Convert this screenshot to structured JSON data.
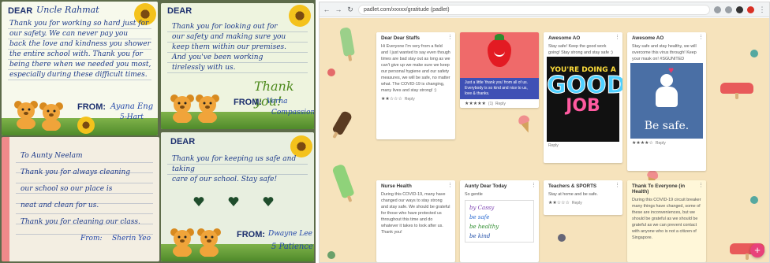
{
  "photo": {
    "card1": {
      "dear": "DEAR",
      "name": "Uncle Rahmat",
      "lines": [
        "Thank you for working so hard just for",
        "our safety. We can never pay you",
        "back the love and kindness you shower",
        "the entire school with. Thank you for",
        "being there when we needed you most,",
        "especially during these difficult times."
      ],
      "from_label": "FROM:",
      "from_name": "Ayana Eng",
      "cls": "5-Hart"
    },
    "card2": {
      "dear": "DEAR",
      "lines": [
        "Thank you for looking out for",
        "our safety and making sure you",
        "keep them within our premises.",
        "And you've been working",
        "tirelessly with us."
      ],
      "shout": "Thank you!",
      "from_label": "FROM:",
      "from_name": "Verna",
      "cls": "Compassion"
    },
    "card3": {
      "lines": [
        "To Aunty Neelam",
        "Thank you for always cleaning",
        "our school so our place is",
        "neat and clean for us.",
        "Thank you for cleaning our class."
      ],
      "from_label": "From:",
      "from_name": "Sherin Yeo"
    },
    "card4": {
      "dear": "DEAR",
      "lines": [
        "Thank you for keeping us safe and taking",
        "care of our school. Stay safe!"
      ],
      "from_label": "FROM:",
      "from_name": "Dwayne Lee",
      "cls": "5 Patience"
    }
  },
  "browser": {
    "nav": {
      "back": "←",
      "forward": "→",
      "reload": "↻"
    },
    "url": "padlet.com/xxxxx/gratitude (padlet)",
    "fab": "+"
  },
  "posts": [
    {
      "title": "Dear Dear Staffs",
      "body": "Hi Everyone I'm very from a field and I just wanted to say even though times are bad stay out as long as we can't give up we make sure we keep our personal hygiene and our safety measures, we will be safe, no matter what. The COVID-19 is changing, many lives and stay strong! :)",
      "stars": "★★☆☆☆",
      "reply": "Reply"
    },
    {
      "banner": "Just a little 'thank you' from all of us. Everybody is so kind and nice to us, love & thanks.",
      "stars": "★★★★★",
      "count": "(1)",
      "reply": "Reply"
    },
    {
      "title": "Awesome AO",
      "body": "Stay safe! Keep the good work going! Stay strong and stay safe :)",
      "img_l1": "YOU'RE DOING A",
      "img_l2": "GOOD",
      "img_l3": "JOB",
      "reply": "Reply"
    },
    {
      "title": "Awesome AO",
      "body": "Stay safe and stay healthy, we will overcome this virus through! Keep your mask on! #SGUNITED",
      "img_text": "Be safe.",
      "stars": "★★★★☆",
      "reply": "Reply"
    },
    {
      "title": "Nurse Health",
      "body": "During this COVID-19, many have changed our ways to stay strong and stay safe. We should be grateful for those who have protected us throughout this time and do whatever it takes to look after us. Thank you!"
    },
    {
      "title": "Aunty Dear Today",
      "body": "So gentle",
      "hw": [
        "by Cassy",
        "be safe",
        "be healthy",
        "be kind"
      ]
    },
    {
      "title": "Teachers & SPORTS",
      "body": "Stay at home and be safe.",
      "stars": "★★☆☆☆",
      "reply": "Reply"
    },
    {
      "title": "Thank To Everyone (in Health)",
      "body": "During this COVID-19 circuit breaker many things have changed, some of these are inconveniences, but we should be grateful as we should be grateful as we can prevent contact with anyone who is not a citizen of Singapore."
    }
  ]
}
